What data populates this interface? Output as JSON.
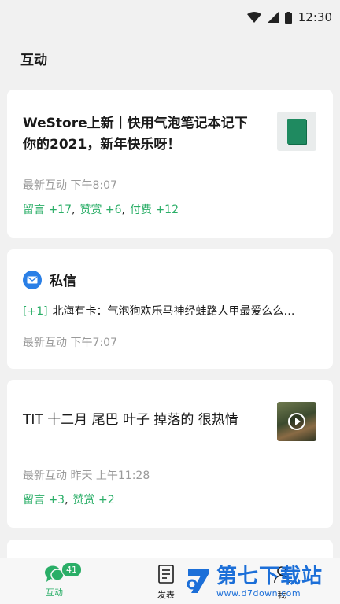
{
  "status_bar": {
    "time": "12:30"
  },
  "page": {
    "title": "互动"
  },
  "cards": [
    {
      "title": "WeStore上新丨快用气泡笔记本记下你的2021，新年快乐呀！",
      "meta": "最新互动  下午8:07",
      "stats": {
        "comments": "留言 +17",
        "rewards": "赞赏 +6",
        "paid": "付费 +12"
      }
    },
    {
      "title": "TIT 十二月 尾巴 叶子 掉落的 很热情",
      "meta": "最新互动 昨天 上午11:28",
      "stats": {
        "comments": "留言 +3",
        "rewards": "赞赏 +2"
      }
    }
  ],
  "messages": {
    "title": "私信",
    "tag": "[+1]",
    "preview": "北海有卡：气泡狗欢乐马神经蛙路人甲最爱么么…",
    "meta": "最新互动  下午7:07"
  },
  "tabs": [
    {
      "label": "互动",
      "badge": "41",
      "active": true
    },
    {
      "label": "发表"
    },
    {
      "label": "我"
    }
  ],
  "watermark": {
    "name": "第七下载站",
    "url": "www.d7down.com"
  },
  "colors": {
    "accent": "#2aae67",
    "mail": "#2a7fe6",
    "watermark": "#1c6fd8"
  }
}
